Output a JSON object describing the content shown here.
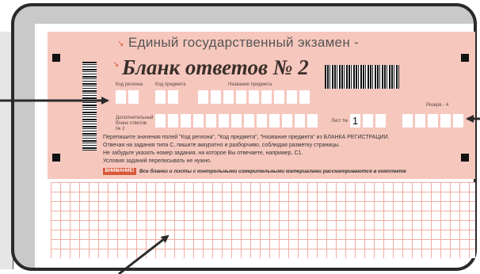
{
  "form": {
    "header": "Единый государственный экзамен -",
    "title": "Бланк ответов № 2",
    "labels": {
      "region_code": "Код региона",
      "subject_code": "Код предмета",
      "subject_name": "Название предмета",
      "additional_blank": "Дополнительный бланк ответов № 2",
      "sheet": "Лист №",
      "reserve": "Резерв - 4"
    },
    "sheet_number": "1",
    "instructions": [
      "Перепишите значения полей \"Код региона\", \"Код предмета\", \"Название предмета\" из БЛАНКА РЕГИСТРАЦИИ.",
      "Отвечая на задания типа С, пишите аккуратно и разборчиво, соблюдая разметку страницы.",
      "Не забудьте указать номер задания, на которое Вы отвечаете, например, С1.",
      "Условия заданий переписывать не нужно."
    ],
    "attention_label": "ВНИМАНИЕ!",
    "attention_note": "Все бланки и листы с контрольными измерительными материалами рассматриваются в комплекте"
  },
  "colors": {
    "panel": "#f6c7bd",
    "accent": "#d9583a",
    "grid": "#f1aea1",
    "frame": "#2a2a2a"
  }
}
